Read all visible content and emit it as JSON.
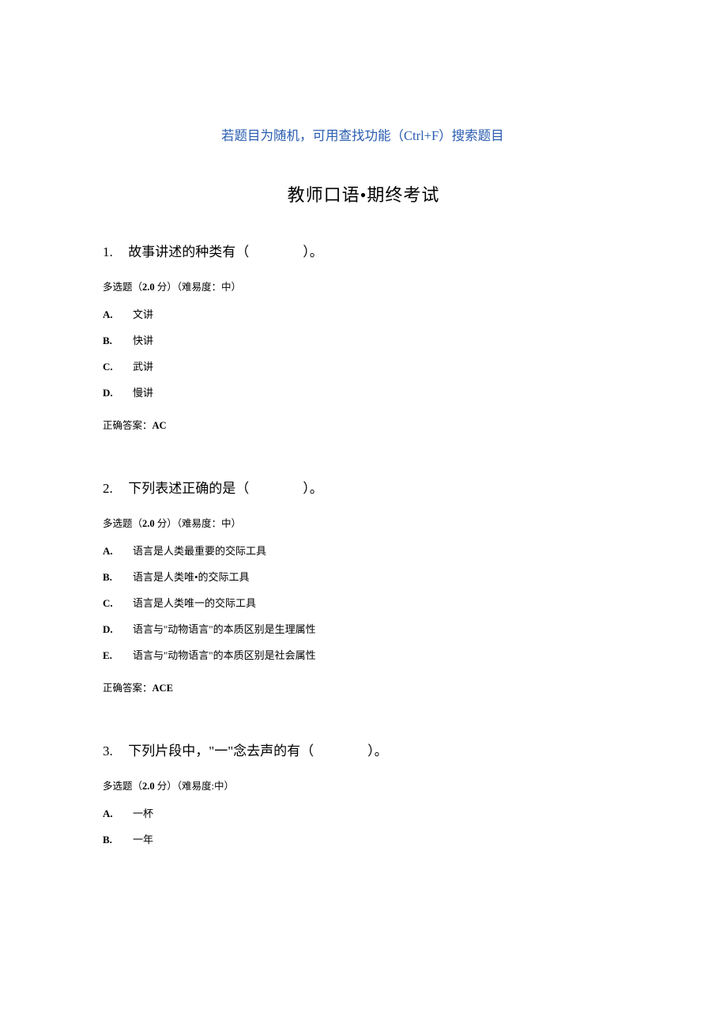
{
  "tip": "若题目为随机，可用查找功能（Ctrl+F）搜索题目",
  "title": "教师口语•期终考试",
  "meta_prefix": "多选题（",
  "meta_points": "2.0",
  "meta_points_suffix": " 分）（难易度：中）",
  "meta_points_suffix_alt": " 分）（难易度:中）",
  "answer_label": "正确答案：",
  "questions": [
    {
      "num": "1.",
      "stem_prefix": "故事讲述的种类有（",
      "stem_blank": "　　　　",
      "stem_suffix": "）。",
      "meta_variant": "normal",
      "options": [
        {
          "letter": "A.",
          "text": "文讲"
        },
        {
          "letter": "B.",
          "text": "快讲"
        },
        {
          "letter": "C.",
          "text": "武讲"
        },
        {
          "letter": "D.",
          "text": "慢讲"
        }
      ],
      "answer": "AC"
    },
    {
      "num": "2.",
      "stem_prefix": "下列表述正确的是（",
      "stem_blank": "　　　　",
      "stem_suffix": "）。",
      "meta_variant": "normal",
      "options": [
        {
          "letter": "A.",
          "text": "语言是人类最重要的交际工具"
        },
        {
          "letter": "B.",
          "text": "语言是人类唯•的交际工具"
        },
        {
          "letter": "C.",
          "text": "语言是人类唯一的交际工具"
        },
        {
          "letter": "D.",
          "text": "语言与\"动物语言\"的本质区别是生理属性"
        },
        {
          "letter": "E.",
          "text": "语言与\"动物语言\"的本质区别是社会属性"
        }
      ],
      "answer": "ACE"
    },
    {
      "num": "3.",
      "stem_prefix": "下列片段中，\"一\"念去声的有（",
      "stem_blank": "　　　　",
      "stem_suffix": "）。",
      "meta_variant": "alt",
      "options": [
        {
          "letter": "A.",
          "text": "一杯"
        },
        {
          "letter": "B.",
          "text": "一年"
        }
      ],
      "answer": ""
    }
  ]
}
